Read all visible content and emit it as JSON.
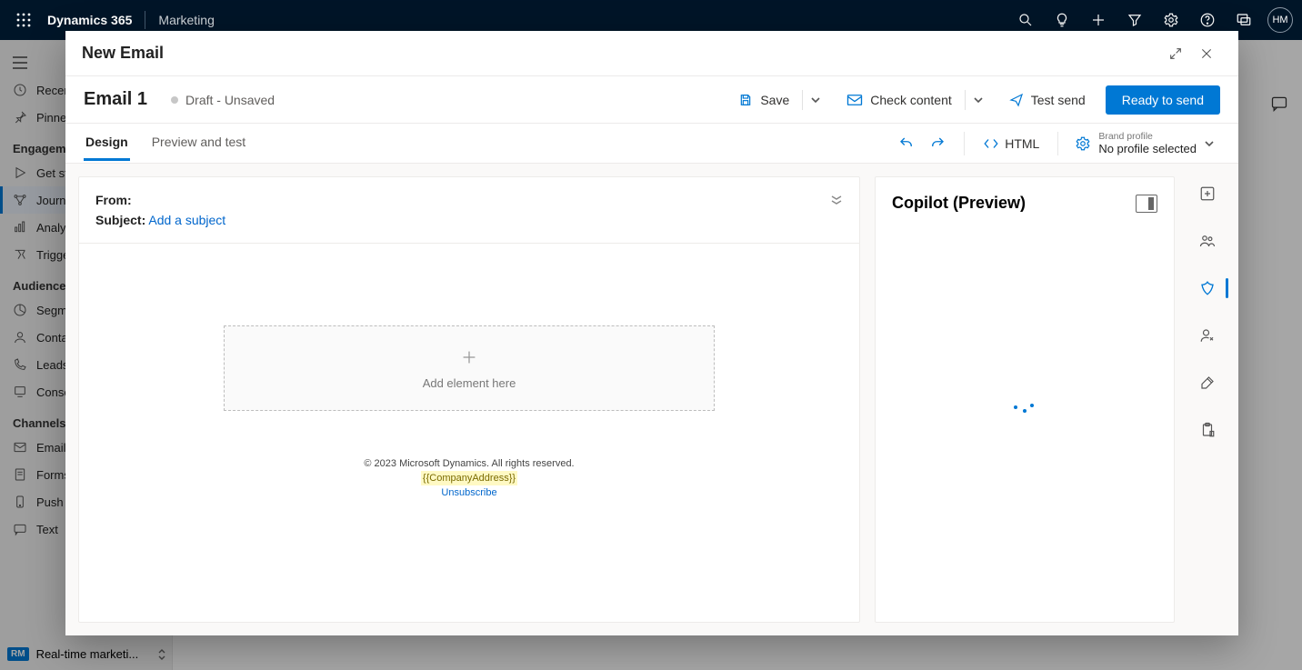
{
  "header": {
    "app": "Dynamics 365",
    "module": "Marketing",
    "avatar": "HM"
  },
  "sidenav": {
    "recent": "Recent",
    "pinned": "Pinned",
    "group_engagement": "Engagement",
    "engagement": {
      "getstarted": "Get started",
      "journeys": "Journeys",
      "analytics": "Analytics",
      "triggers": "Triggers"
    },
    "group_audience": "Audience",
    "audience": {
      "segments": "Segments",
      "contacts": "Contacts",
      "leads": "Leads",
      "consent": "Consent"
    },
    "group_channels": "Channels",
    "channels": {
      "emails": "Emails",
      "forms": "Forms",
      "push": "Push",
      "text": "Text"
    },
    "app_switch_badge": "RM",
    "app_switch_label": "Real-time marketi..."
  },
  "modal": {
    "title": "New Email",
    "email_name": "Email 1",
    "status": "Draft - Unsaved",
    "actions": {
      "save": "Save",
      "check": "Check content",
      "testsend": "Test send",
      "ready": "Ready to send"
    },
    "tabs": {
      "design": "Design",
      "preview": "Preview and test"
    },
    "html_btn": "HTML",
    "brand": {
      "label_sm": "Brand profile",
      "label": "No profile selected"
    },
    "from_label": "From:",
    "subject_label": "Subject:",
    "subject_link": "Add a subject",
    "dropzone": "Add element here",
    "footer": {
      "copyright": "© 2023 Microsoft Dynamics. All rights reserved.",
      "token": "{{CompanyAddress}}",
      "unsub": "Unsubscribe"
    }
  },
  "copilot": {
    "title": "Copilot (Preview)"
  }
}
